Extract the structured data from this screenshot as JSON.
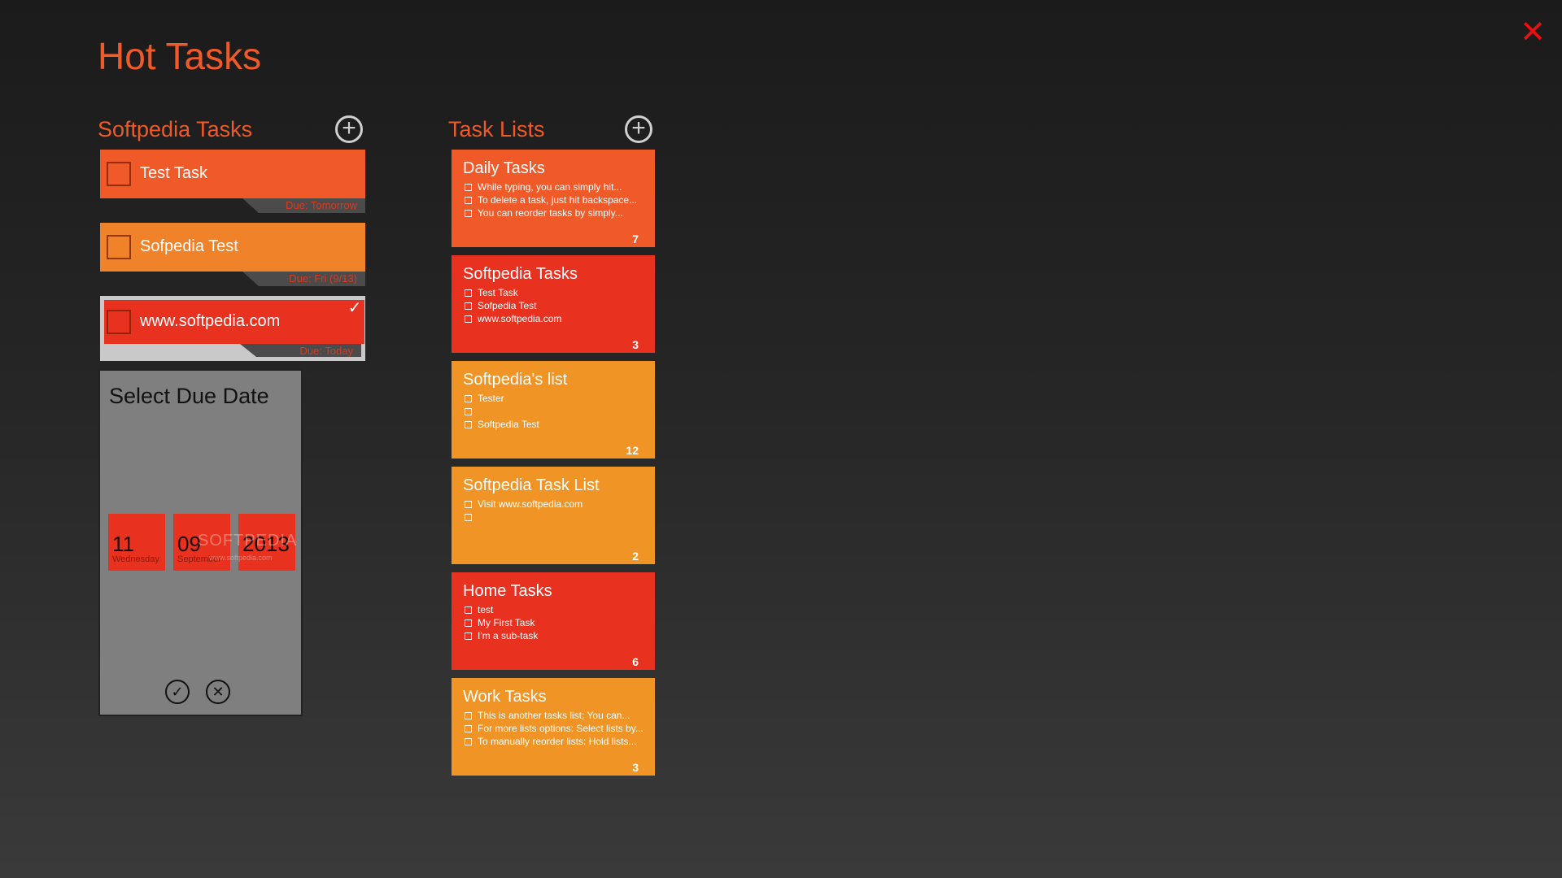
{
  "app": {
    "title": "Hot Tasks",
    "close_glyph": "✕"
  },
  "tasks_section": {
    "title": "Softpedia Tasks",
    "add_glyph": "+",
    "items": [
      {
        "label": "Test Task",
        "due": "Due: Tomorrow",
        "color": "#f05a28"
      },
      {
        "label": "Sofpedia Test",
        "due": "Due: Fri (9/13)",
        "color": "#f0822a"
      },
      {
        "label": "www.softpedia.com",
        "due": "Due: Today",
        "color": "#e8311e",
        "selected": true
      }
    ]
  },
  "picker": {
    "title": "Select Due Date",
    "day": {
      "num": "11",
      "sub": "Wednesday"
    },
    "month": {
      "num": "09",
      "sub": "September"
    },
    "year": {
      "num": "2013",
      "sub": ""
    },
    "watermark": "SOFTPEDIA",
    "watermark_sub": "www.softpedia.com",
    "ok_glyph": "✓",
    "cancel_glyph": "✕"
  },
  "lists_section": {
    "title": "Task Lists",
    "add_glyph": "+",
    "lists": [
      {
        "name": "Daily Tasks",
        "color": "#f05a28",
        "count": "7",
        "items": [
          "While typing, you can simply hit...",
          "To delete a task, just hit backspace...",
          "You can reorder tasks by simply..."
        ]
      },
      {
        "name": "Softpedia Tasks",
        "color": "#e8311e",
        "count": "3",
        "items": [
          "Test Task",
          "Sofpedia Test",
          "www.softpedia.com"
        ]
      },
      {
        "name": "Softpedia's list",
        "color": "#f09426",
        "count": "12",
        "items": [
          "Tester",
          "",
          "Softpedia Test"
        ]
      },
      {
        "name": "Softpedia Task List",
        "color": "#f09426",
        "count": "2",
        "items": [
          "Visit www.softpedia.com",
          ""
        ]
      },
      {
        "name": "Home Tasks",
        "color": "#e8311e",
        "count": "6",
        "items": [
          "test",
          "My First Task",
          "I'm a sub-task"
        ]
      },
      {
        "name": "Work Tasks",
        "color": "#f09426",
        "count": "3",
        "items": [
          "This is another tasks list; You can...",
          "For more lists options: Select lists by...",
          "To manually reorder lists: Hold lists..."
        ]
      }
    ]
  }
}
